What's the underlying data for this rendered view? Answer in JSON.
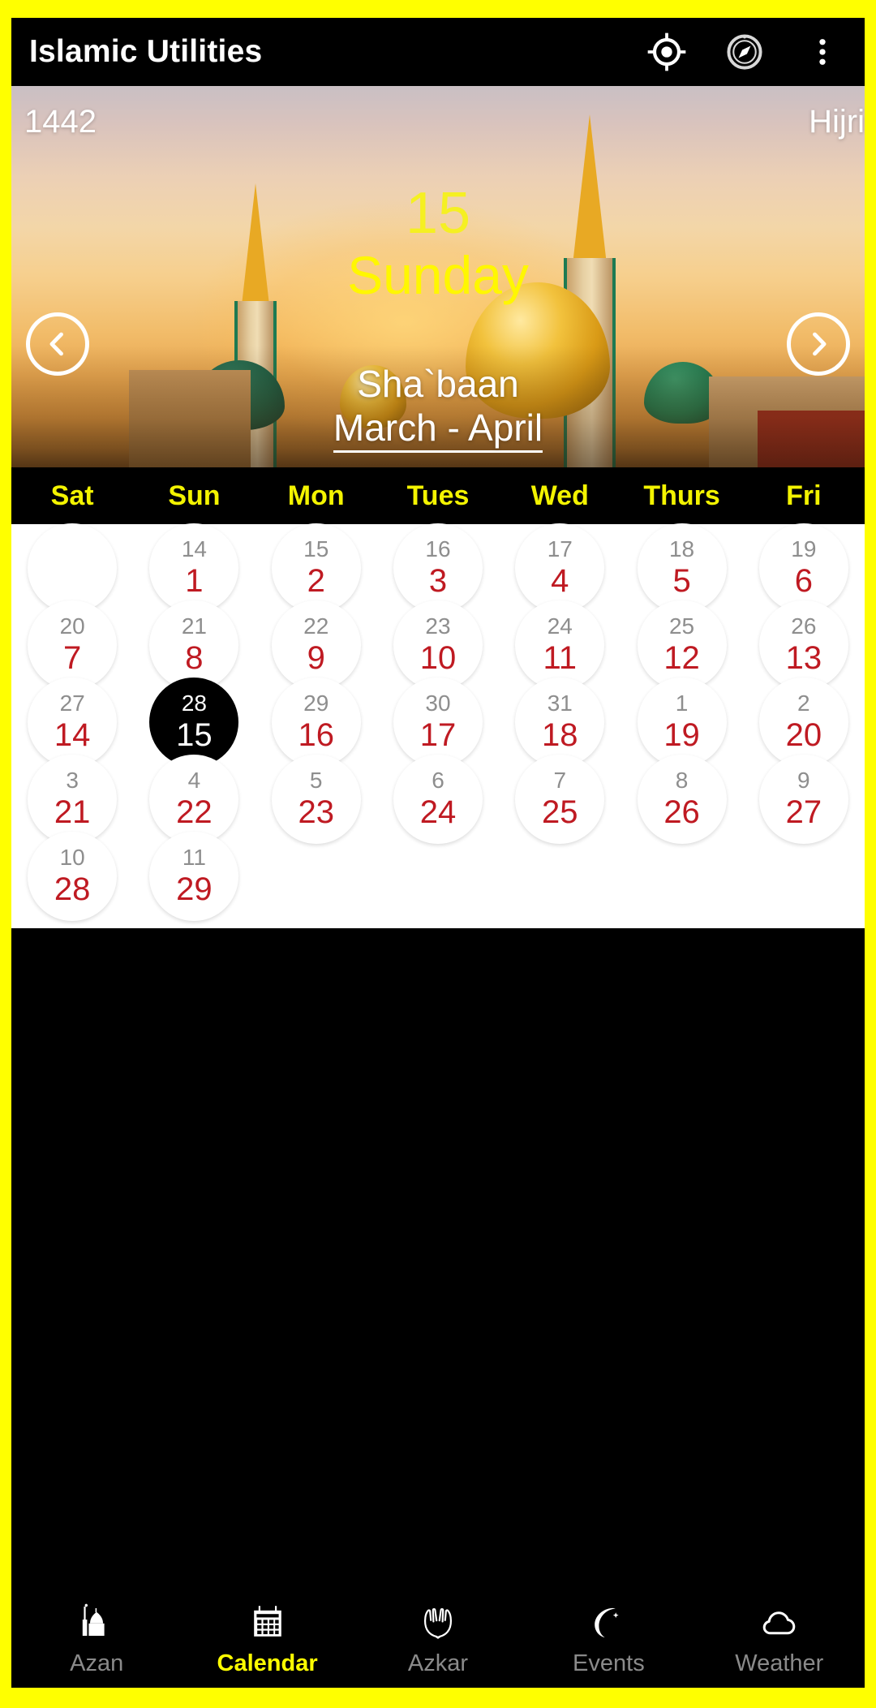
{
  "appbar": {
    "title": "Islamic Utilities",
    "icons": [
      {
        "name": "location-crosshair-icon"
      },
      {
        "name": "compass-icon"
      },
      {
        "name": "overflow-menu-icon"
      }
    ]
  },
  "hero": {
    "hijri_year": "1442",
    "calendar_type_label": "Hijri",
    "day_number": "15",
    "day_name": "Sunday",
    "hijri_month": "Sha`baan",
    "gregorian_range": "March - April",
    "prev_label": "‹",
    "next_label": "›"
  },
  "weekdays": [
    "Sat",
    "Sun",
    "Mon",
    "Tues",
    "Wed",
    "Thurs",
    "Fri"
  ],
  "calendar": {
    "selected_gregorian": "28",
    "selected_hijri": "15",
    "rows": [
      [
        {
          "greg": "",
          "hijri": "",
          "empty": true
        },
        {
          "greg": "14",
          "hijri": "1"
        },
        {
          "greg": "15",
          "hijri": "2"
        },
        {
          "greg": "16",
          "hijri": "3"
        },
        {
          "greg": "17",
          "hijri": "4"
        },
        {
          "greg": "18",
          "hijri": "5"
        },
        {
          "greg": "19",
          "hijri": "6"
        }
      ],
      [
        {
          "greg": "20",
          "hijri": "7"
        },
        {
          "greg": "21",
          "hijri": "8"
        },
        {
          "greg": "22",
          "hijri": "9"
        },
        {
          "greg": "23",
          "hijri": "10"
        },
        {
          "greg": "24",
          "hijri": "11"
        },
        {
          "greg": "25",
          "hijri": "12"
        },
        {
          "greg": "26",
          "hijri": "13"
        }
      ],
      [
        {
          "greg": "27",
          "hijri": "14"
        },
        {
          "greg": "28",
          "hijri": "15",
          "selected": true
        },
        {
          "greg": "29",
          "hijri": "16"
        },
        {
          "greg": "30",
          "hijri": "17"
        },
        {
          "greg": "31",
          "hijri": "18"
        },
        {
          "greg": "1",
          "hijri": "19"
        },
        {
          "greg": "2",
          "hijri": "20"
        }
      ],
      [
        {
          "greg": "3",
          "hijri": "21"
        },
        {
          "greg": "4",
          "hijri": "22"
        },
        {
          "greg": "5",
          "hijri": "23"
        },
        {
          "greg": "6",
          "hijri": "24"
        },
        {
          "greg": "7",
          "hijri": "25"
        },
        {
          "greg": "8",
          "hijri": "26"
        },
        {
          "greg": "9",
          "hijri": "27"
        }
      ],
      [
        {
          "greg": "10",
          "hijri": "28"
        },
        {
          "greg": "11",
          "hijri": "29"
        },
        {
          "greg": "",
          "hijri": "",
          "blank": true
        },
        {
          "greg": "",
          "hijri": "",
          "blank": true
        },
        {
          "greg": "",
          "hijri": "",
          "blank": true
        },
        {
          "greg": "",
          "hijri": "",
          "blank": true
        },
        {
          "greg": "",
          "hijri": "",
          "blank": true
        }
      ]
    ]
  },
  "bottom_nav": {
    "items": [
      {
        "label": "Azan",
        "icon": "mosque-icon",
        "active": false
      },
      {
        "label": "Calendar",
        "icon": "calendar-icon",
        "active": true
      },
      {
        "label": "Azkar",
        "icon": "praying-hands-icon",
        "active": false
      },
      {
        "label": "Events",
        "icon": "crescent-moon-icon",
        "active": false
      },
      {
        "label": "Weather",
        "icon": "cloud-icon",
        "active": false
      }
    ]
  },
  "colors": {
    "frame_yellow": "#FFFF00",
    "accent_yellow": "#FFF700",
    "hijri_red": "#BF1A22",
    "gregorian_gray": "#8E8E8E",
    "bar_black": "#000000",
    "inactive_nav": "#8A8A8A"
  }
}
